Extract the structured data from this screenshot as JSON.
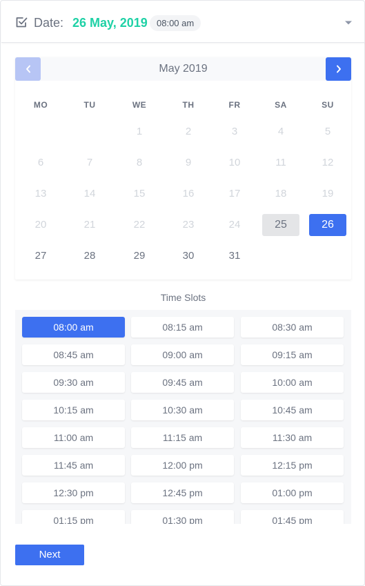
{
  "header": {
    "label": "Date:",
    "date_value": "26 May, 2019",
    "time_badge": "08:00 am"
  },
  "calendar": {
    "month_title": "May 2019",
    "weekdays": [
      "MO",
      "TU",
      "WE",
      "TH",
      "FR",
      "SA",
      "SU"
    ],
    "weeks": [
      [
        "",
        "",
        "1",
        "2",
        "3",
        "4",
        "5"
      ],
      [
        "6",
        "7",
        "8",
        "9",
        "10",
        "11",
        "12"
      ],
      [
        "13",
        "14",
        "15",
        "16",
        "17",
        "18",
        "19"
      ],
      [
        "20",
        "21",
        "22",
        "23",
        "24",
        "25",
        "26"
      ],
      [
        "27",
        "28",
        "29",
        "30",
        "31",
        "",
        ""
      ]
    ],
    "today": "25",
    "selected": "26",
    "enabled_from": "26"
  },
  "time_slots": {
    "title": "Time Slots",
    "selected": "08:00 am",
    "slots": [
      "08:00 am",
      "08:15 am",
      "08:30 am",
      "08:45 am",
      "09:00 am",
      "09:15 am",
      "09:30 am",
      "09:45 am",
      "10:00 am",
      "10:15 am",
      "10:30 am",
      "10:45 am",
      "11:00 am",
      "11:15 am",
      "11:30 am",
      "11:45 am",
      "12:00 pm",
      "12:15 pm",
      "12:30 pm",
      "12:45 pm",
      "01:00 pm",
      "01:15 pm",
      "01:30 pm",
      "01:45 pm"
    ]
  },
  "actions": {
    "next_label": "Next"
  },
  "icons": {
    "header_check": "checkbox-checked-icon",
    "header_toggle": "caret-down-icon",
    "prev": "chevron-left-icon",
    "next": "chevron-right-icon"
  },
  "colors": {
    "accent": "#3d70f0",
    "accent_disabled": "#b7c5f5",
    "date_green": "#1fd1a6"
  }
}
